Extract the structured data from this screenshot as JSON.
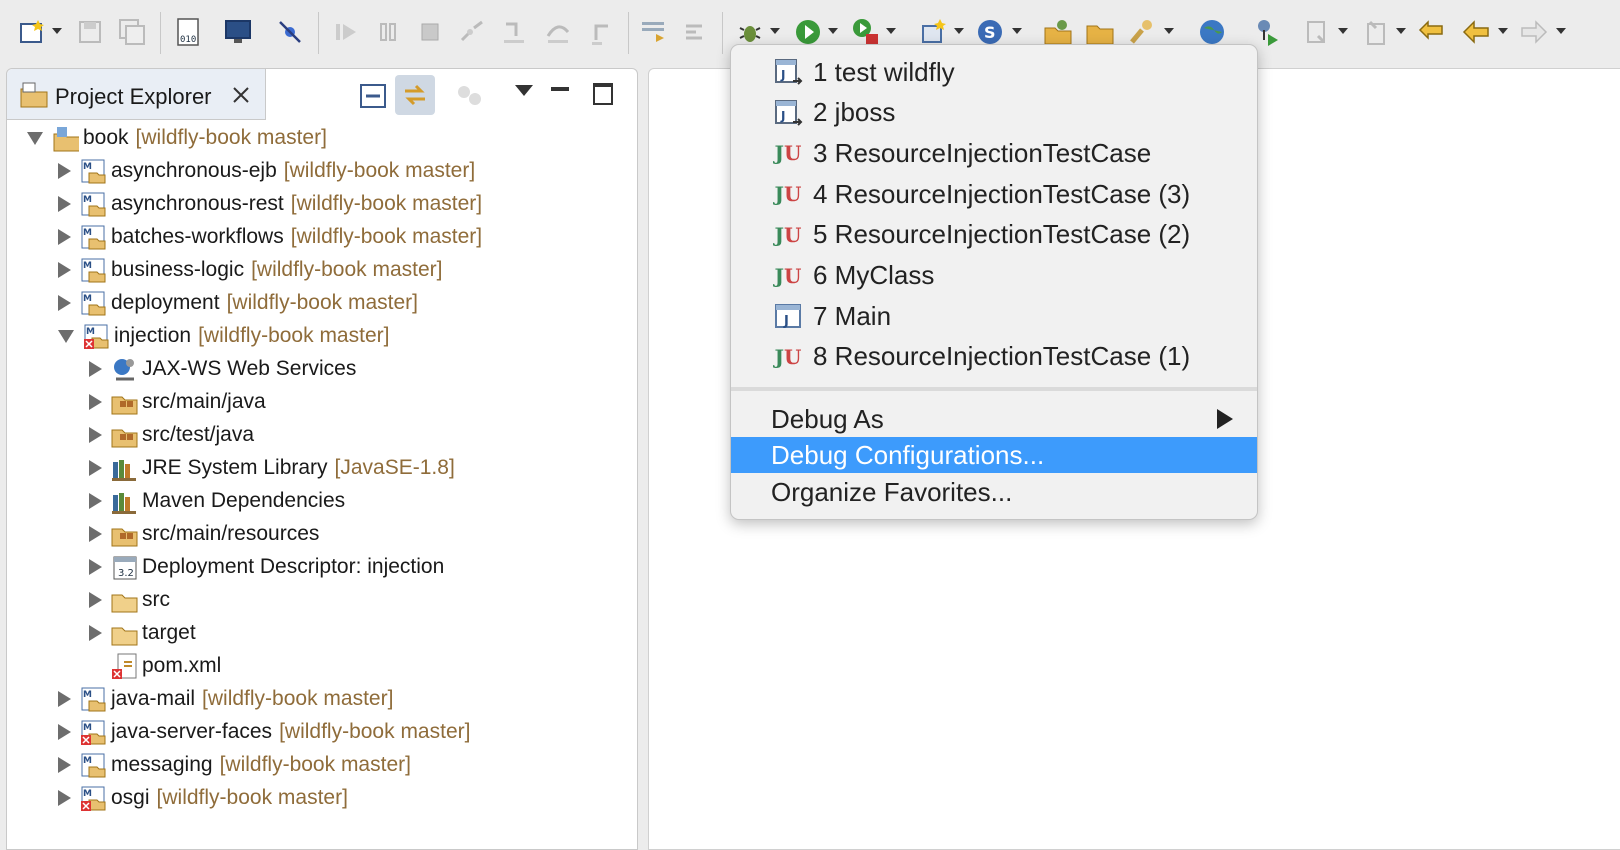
{
  "toolbar": {
    "buttons": [
      "new-icon",
      "save-icon",
      "save-all-icon",
      "binary-icon",
      "console-icon",
      "skip-breakpoints-icon",
      "resume-icon",
      "suspend-icon",
      "terminate-icon",
      "disconnect-icon",
      "step-into-icon",
      "step-over-icon",
      "step-return-icon",
      "drop-to-frame-icon",
      "use-step-filters-icon",
      "debug-icon",
      "run-icon",
      "run-external-icon",
      "new-server-icon",
      "new-java-class-icon",
      "open-type-icon",
      "open-task-icon",
      "search-icon",
      "web-browser-icon",
      "run-ant-icon",
      "next-annotation-icon",
      "previous-annotation-icon",
      "last-edit-location-icon",
      "back-icon",
      "forward-icon"
    ]
  },
  "explorer": {
    "title": "Project Explorer",
    "tree": [
      {
        "label": "book",
        "decoration": "[wildfly-book master]"
      },
      {
        "label": "asynchronous-ejb",
        "decoration": "[wildfly-book master]"
      },
      {
        "label": "asynchronous-rest",
        "decoration": "[wildfly-book master]"
      },
      {
        "label": "batches-workflows",
        "decoration": "[wildfly-book master]"
      },
      {
        "label": "business-logic",
        "decoration": "[wildfly-book master]"
      },
      {
        "label": "deployment",
        "decoration": "[wildfly-book master]"
      },
      {
        "label": "injection",
        "decoration": "[wildfly-book master]"
      },
      {
        "label": "JAX-WS Web Services",
        "decoration": ""
      },
      {
        "label": "src/main/java",
        "decoration": ""
      },
      {
        "label": "src/test/java",
        "decoration": ""
      },
      {
        "label": "JRE System Library",
        "decoration": "[JavaSE-1.8]"
      },
      {
        "label": "Maven Dependencies",
        "decoration": ""
      },
      {
        "label": "src/main/resources",
        "decoration": ""
      },
      {
        "label": "Deployment Descriptor: injection",
        "decoration": ""
      },
      {
        "label": "src",
        "decoration": ""
      },
      {
        "label": "target",
        "decoration": ""
      },
      {
        "label": "pom.xml",
        "decoration": ""
      },
      {
        "label": "java-mail",
        "decoration": "[wildfly-book master]"
      },
      {
        "label": "java-server-faces",
        "decoration": "[wildfly-book master]"
      },
      {
        "label": "messaging",
        "decoration": "[wildfly-book master]"
      },
      {
        "label": "osgi",
        "decoration": "[wildfly-book master]"
      }
    ]
  },
  "menu": {
    "history": [
      {
        "label": "1 test wildfly",
        "icon": "launch-config-icon"
      },
      {
        "label": "2 jboss",
        "icon": "launch-config-icon"
      },
      {
        "label": "3 ResourceInjectionTestCase",
        "icon": "junit-icon"
      },
      {
        "label": "4 ResourceInjectionTestCase (3)",
        "icon": "junit-icon"
      },
      {
        "label": "5 ResourceInjectionTestCase (2)",
        "icon": "junit-icon"
      },
      {
        "label": "6 MyClass",
        "icon": "junit-icon"
      },
      {
        "label": "7 Main",
        "icon": "java-app-icon"
      },
      {
        "label": "8 ResourceInjectionTestCase (1)",
        "icon": "junit-icon"
      }
    ],
    "debug_as": "Debug As",
    "debug_configurations": "Debug Configurations...",
    "organize_favorites": "Organize Favorites...",
    "selected_color": "#3d9bfc"
  }
}
